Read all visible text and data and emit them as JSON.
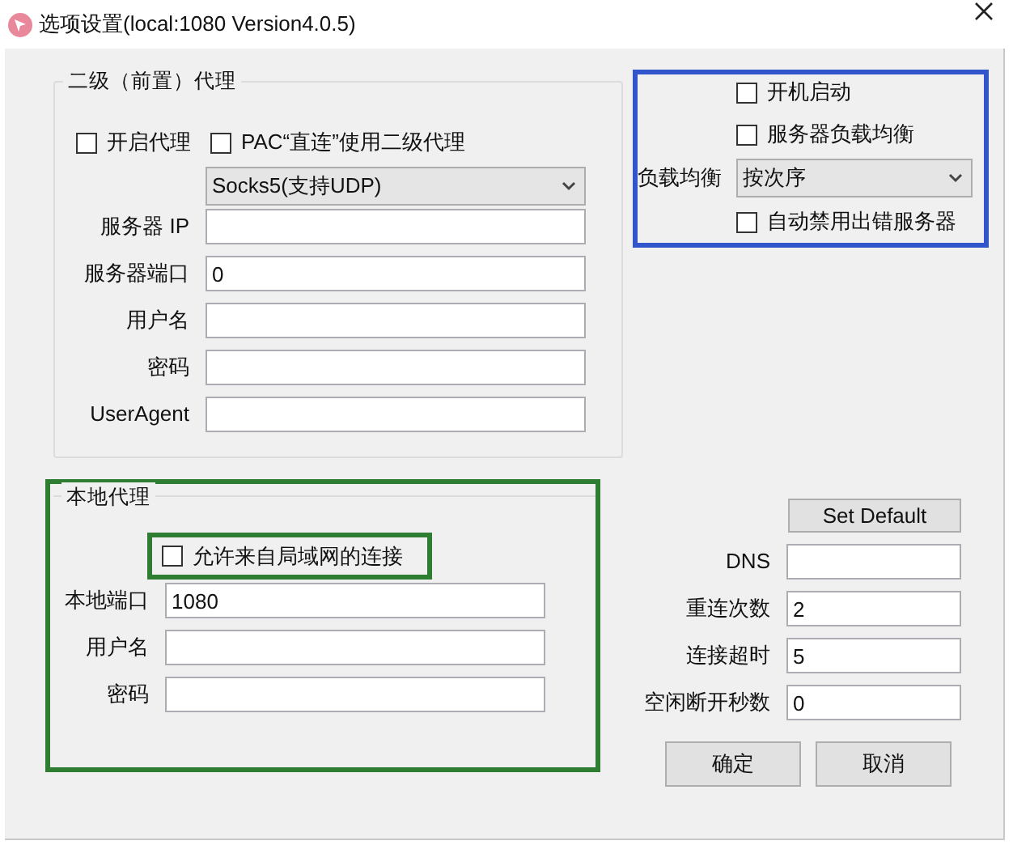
{
  "window": {
    "title": "选项设置(local:1080 Version4.0.5)"
  },
  "upstream_proxy": {
    "title": "二级（前置）代理",
    "options": [
      {
        "label": "开启代理",
        "checked": false
      },
      {
        "label": "PAC“直连”使用二级代理",
        "checked": false
      }
    ],
    "proxy_type": {
      "value": "Socks5(支持UDP)"
    },
    "fields": [
      {
        "label": "服务器 IP"
      },
      {
        "label": "服务器端口",
        "value": "0"
      },
      {
        "label": "用户名"
      },
      {
        "label": "密码"
      },
      {
        "label": "UserAgent"
      }
    ]
  },
  "startup": [
    {
      "kind": "checkbox",
      "label": "开机启动",
      "checked": false
    },
    {
      "kind": "checkbox",
      "label": "服务器负载均衡",
      "checked": false
    },
    {
      "kind": "select",
      "label": "负载均衡",
      "value": "按次序"
    },
    {
      "kind": "checkbox",
      "label": "自动禁用出错服务器",
      "checked": false
    }
  ],
  "local_proxy": {
    "title": "本地代理",
    "allow_lan": {
      "label": "允许来自局域网的连接",
      "checked": false
    },
    "fields": [
      {
        "label": "本地端口",
        "value": "1080"
      },
      {
        "label": "用户名"
      },
      {
        "label": "密码"
      }
    ]
  },
  "set_default_button": "Set Default",
  "advanced_fields": [
    {
      "label": "DNS"
    },
    {
      "label": "重连次数",
      "value": "2"
    },
    {
      "label": "连接超时",
      "value": "5"
    },
    {
      "label": "空闲断开秒数",
      "value": "0"
    }
  ],
  "buttons": [
    "确定",
    "取消"
  ]
}
